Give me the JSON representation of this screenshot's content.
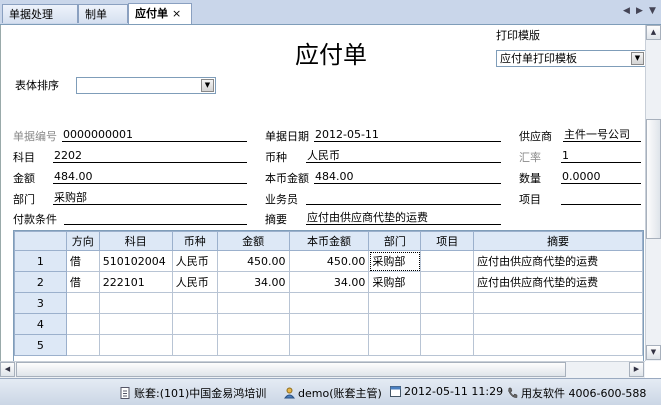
{
  "tabs": [
    {
      "label": "单据处理"
    },
    {
      "label": "制单"
    },
    {
      "label": "应付单",
      "close": "×"
    }
  ],
  "nav": {
    "left": "◀",
    "right": "▶",
    "down": "▼"
  },
  "form": {
    "title": "应付单",
    "print_template_label": "打印模版",
    "print_template_value": "应付单打印模板",
    "sort_label": "表体排序",
    "sort_value": "",
    "fields": {
      "doc_no_label": "单据编号",
      "doc_no": "0000000001",
      "doc_date_label": "单据日期",
      "doc_date": "2012-05-11",
      "supplier_label": "供应商",
      "supplier": "主件一号公司",
      "subject_label": "科目",
      "subject": "2202",
      "currency_label": "币种",
      "currency": "人民币",
      "rate_label": "汇率",
      "rate": "1",
      "amount_label": "金额",
      "amount": "484.00",
      "local_amount_label": "本币金额",
      "local_amount": "484.00",
      "qty_label": "数量",
      "qty": "0.0000",
      "dept_label": "部门",
      "dept": "采购部",
      "salesman_label": "业务员",
      "salesman": "",
      "project_label": "项目",
      "project": "",
      "pay_terms_label": "付款条件",
      "pay_terms": "",
      "summary_label": "摘要",
      "summary": "应付由供应商代垫的运费"
    }
  },
  "grid": {
    "columns": [
      "",
      "方向",
      "科目",
      "币种",
      "金额",
      "本币金额",
      "部门",
      "项目",
      "摘要"
    ],
    "rows": [
      {
        "n": "1",
        "dir": "借",
        "subject": "510102004",
        "currency": "人民币",
        "amount": "450.00",
        "local": "450.00",
        "dept": "采购部",
        "project": "",
        "summary": "应付由供应商代垫的运费"
      },
      {
        "n": "2",
        "dir": "借",
        "subject": "222101",
        "currency": "人民币",
        "amount": "34.00",
        "local": "34.00",
        "dept": "采购部",
        "project": "",
        "summary": "应付由供应商代垫的运费"
      },
      {
        "n": "3",
        "dir": "",
        "subject": "",
        "currency": "",
        "amount": "",
        "local": "",
        "dept": "",
        "project": "",
        "summary": ""
      },
      {
        "n": "4",
        "dir": "",
        "subject": "",
        "currency": "",
        "amount": "",
        "local": "",
        "dept": "",
        "project": "",
        "summary": ""
      },
      {
        "n": "5",
        "dir": "",
        "subject": "",
        "currency": "",
        "amount": "",
        "local": "",
        "dept": "",
        "project": "",
        "summary": ""
      }
    ]
  },
  "status": {
    "account": "账套:(101)中国金易鸿培训",
    "user": "demo(账套主管)",
    "datetime": "2012-05-11  11:29",
    "vendor": "用友软件  4006-600-588"
  },
  "icons": {
    "arrow": "▼",
    "up": "▲",
    "left": "◀",
    "right": "▶"
  }
}
